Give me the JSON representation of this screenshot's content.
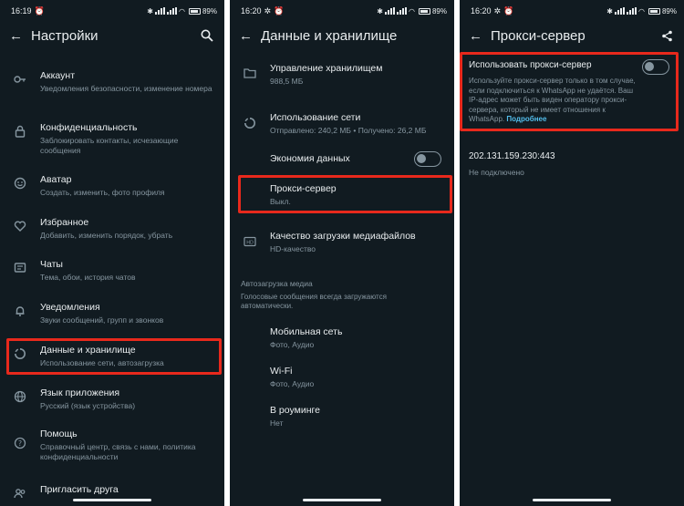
{
  "status": {
    "p1_time": "16:19",
    "p2_time": "16:20",
    "p3_time": "16:20",
    "battery": "89"
  },
  "p1": {
    "title": "Настройки",
    "items": [
      {
        "title": "Аккаунт",
        "sub": "Уведомления безопасности, изменение номера",
        "icon": "key-icon"
      },
      {
        "title": "Конфиденциальность",
        "sub": "Заблокировать контакты, исчезающие сообщения",
        "icon": "lock-icon"
      },
      {
        "title": "Аватар",
        "sub": "Создать, изменить, фото профиля",
        "icon": "avatar-icon"
      },
      {
        "title": "Избранное",
        "sub": "Добавить, изменить порядок, убрать",
        "icon": "heart-icon"
      },
      {
        "title": "Чаты",
        "sub": "Тема, обои, история чатов",
        "icon": "chat-icon"
      },
      {
        "title": "Уведомления",
        "sub": "Звуки сообщений, групп и звонков",
        "icon": "bell-icon"
      },
      {
        "title": "Данные и хранилище",
        "sub": "Использование сети, автозагрузка",
        "icon": "data-circle-icon"
      },
      {
        "title": "Язык приложения",
        "sub": "Русский (язык устройства)",
        "icon": "globe-icon"
      },
      {
        "title": "Помощь",
        "sub": "Справочный центр, связь с нами, политика конфиденциальности",
        "icon": "help-icon"
      },
      {
        "title": "Пригласить друга",
        "sub": "",
        "icon": "people-icon"
      }
    ]
  },
  "p2": {
    "title": "Данные и хранилище",
    "storage": {
      "title": "Управление хранилищем",
      "sub": "988,5 МБ"
    },
    "network": {
      "title": "Использование сети",
      "sub": "Отправлено: 240,2 МБ • Получено: 26,2 МБ"
    },
    "saver": {
      "title": "Экономия данных"
    },
    "proxy": {
      "title": "Прокси-сервер",
      "sub": "Выкл."
    },
    "media_quality": {
      "title": "Качество загрузки медиафайлов",
      "sub": "HD-качество"
    },
    "autodownload": {
      "header": "Автозагрузка медиа",
      "note": "Голосовые сообщения всегда загружаются автоматически."
    },
    "mobile": {
      "title": "Мобильная сеть",
      "sub": "Фото, Аудио"
    },
    "wifi": {
      "title": "Wi-Fi",
      "sub": "Фото, Аудио"
    },
    "roaming": {
      "title": "В роуминге",
      "sub": "Нет"
    }
  },
  "p3": {
    "title": "Прокси-сервер",
    "use_title": "Использовать прокси-сервер",
    "use_desc": "Используйте прокси-сервер только в том случае, если подключиться к WhatsApp не удаётся. Ваш IP-адрес может быть виден оператору прокси-сервера, который не имеет отношения к WhatsApp.",
    "more_link": "Подробнее",
    "address": "202.131.159.230:443",
    "state": "Не подключено"
  },
  "colors": {
    "bg": "#111b21",
    "primary_text": "#e9edef",
    "secondary_text": "#8696a0",
    "highlight": "#e8291c",
    "link": "#53bdeb"
  }
}
